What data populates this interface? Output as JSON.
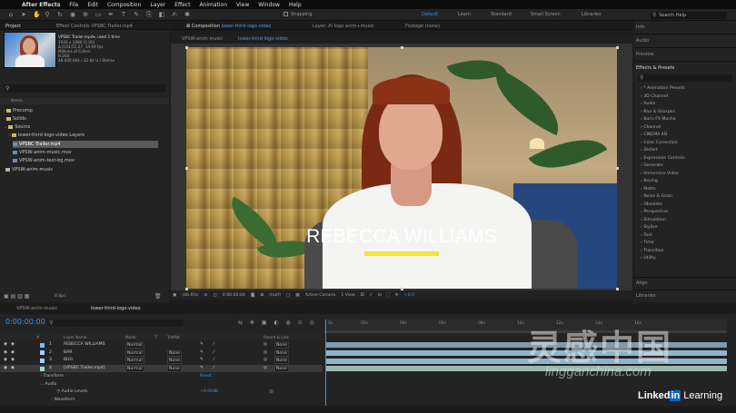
{
  "menubar": {
    "app": "After Effects",
    "items": [
      "File",
      "Edit",
      "Composition",
      "Layer",
      "Effect",
      "Animation",
      "View",
      "Window",
      "Help"
    ]
  },
  "toolbar": {
    "snapping": "Snapping",
    "workspaces": [
      "Default",
      "Learn",
      "Standard",
      "Small Screen",
      "Libraries"
    ],
    "active_workspace": "Default",
    "search_help": "Search Help"
  },
  "project_panel": {
    "tabs": [
      "Project",
      "Effect Controls VPSBC Trailer.mp4"
    ],
    "selected_file": "VPSBC Trailer.mp4",
    "used": ", used 1 time",
    "meta": [
      "1920 x 1080 (1.00)",
      "Δ 0;03;51;27, 14.94 fps",
      "Millions of Colors",
      "H.264",
      "48.000 kHz / 32 bit U / Stereo"
    ],
    "column_name": "Name",
    "items": [
      {
        "label": "Precomp",
        "kind": "folder",
        "indent": 1
      },
      {
        "label": "Solids",
        "kind": "folder",
        "indent": 1
      },
      {
        "label": "Source",
        "kind": "folder",
        "indent": 1
      },
      {
        "label": "lower-third-logo-video Layers",
        "kind": "folder",
        "indent": 2
      },
      {
        "label": "VPSBC Trailer.mp4",
        "kind": "file",
        "indent": 3,
        "selected": true
      },
      {
        "label": "VPSW-anim-music.mov",
        "kind": "file",
        "indent": 3
      },
      {
        "label": "VPSW-anim-text-bg.mov",
        "kind": "file",
        "indent": 3
      },
      {
        "label": "VPSW-anim-music",
        "kind": "comp",
        "indent": 1
      }
    ],
    "bpc": "8 bpc"
  },
  "viewer": {
    "tabs": [
      {
        "label": "Composition ",
        "highlight": "lower-third-logo-video",
        "active": true
      },
      {
        "label": "Layer: AI logo anim+music",
        "active": false
      },
      {
        "label": "Footage (none)",
        "active": false
      }
    ],
    "subtabs": [
      "VPSW-anim-music",
      "lower-third-logo-video"
    ],
    "overlay_name": "REBECCA WILLIAMS",
    "zoom": "(48.6%)",
    "timecode": "0:00:00:00",
    "resolution": "(Half)",
    "camera": "Active Camera",
    "view": "1 View",
    "exposure": "+0.0",
    "accent_color": "#f2e43a"
  },
  "right_panel": {
    "top": [
      "Info",
      "Audio",
      "Preview"
    ],
    "effects_title": "Effects & Presets",
    "effects": [
      "* Animation Presets",
      "3D Channel",
      "Audio",
      "Blur & Sharpen",
      "Boris FX Mocha",
      "Channel",
      "CINEMA 4D",
      "Color Correction",
      "Distort",
      "Expression Controls",
      "Generate",
      "Immersive Video",
      "Keying",
      "Matte",
      "Noise & Grain",
      "Obsolete",
      "Perspective",
      "Simulation",
      "Stylize",
      "Text",
      "Time",
      "Transition",
      "Utility"
    ],
    "bottom": [
      "Align",
      "Libraries"
    ]
  },
  "timeline": {
    "tabs": [
      "VPSW-anim-music",
      "lower-third-logo-video"
    ],
    "timecode": "0:00:00:00",
    "ruler": [
      "0s",
      "02s",
      "04s",
      "06s",
      "08s",
      "10s",
      "12s",
      "14s",
      "16s"
    ],
    "columns": [
      "#",
      "Layer Name",
      "Mode",
      "T",
      "TrkMat",
      "Parent & Link"
    ],
    "layers": [
      {
        "num": "1",
        "name": "REBECCA WILLIAMS",
        "mode": "Normal",
        "trkmat": "",
        "parent": "None",
        "color": "#6ec0ff"
      },
      {
        "num": "2",
        "name": "BAR",
        "mode": "Normal",
        "trkmat": "None",
        "parent": "None",
        "color": "#a0d0ff"
      },
      {
        "num": "3",
        "name": "BUG",
        "mode": "Normal",
        "trkmat": "None",
        "parent": "None",
        "color": "#a0d0ff"
      },
      {
        "num": "4",
        "name": "[VPSBC Trailer.mp4]",
        "mode": "Normal",
        "trkmat": "None",
        "parent": "None",
        "color": "#a8d8c8"
      }
    ],
    "sub": [
      {
        "label": "Transform",
        "value": "Reset"
      },
      {
        "label": "Audio",
        "value": ""
      },
      {
        "label": "Audio Levels",
        "value": "+0.00dB"
      },
      {
        "label": "Waveform",
        "value": ""
      }
    ]
  },
  "watermark": {
    "cn": "灵感中国",
    "url": "lingganchina.com"
  },
  "brand": {
    "linked": "Linked",
    "in": "in",
    "learning": " Learning"
  }
}
